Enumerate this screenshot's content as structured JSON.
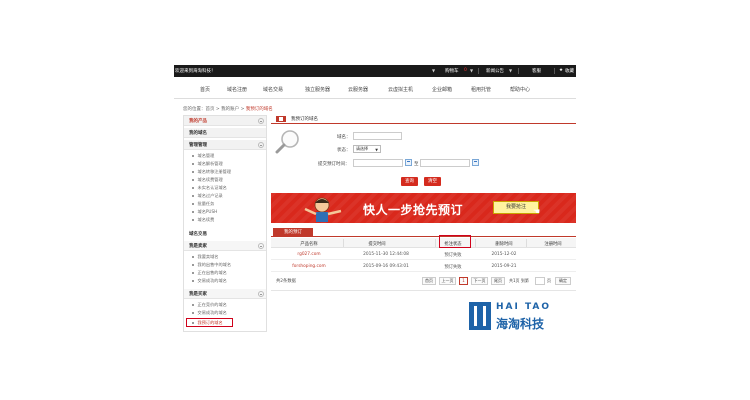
{
  "topbar": {
    "welcome": "欢迎来到海淘科技！",
    "items": [
      "购物车",
      "新闻公告",
      "客服",
      "收藏"
    ],
    "cart_count": "0"
  },
  "nav": [
    "首页",
    "域名注册",
    "域名交易",
    "独立服务器",
    "云服务器",
    "云虚拟主机",
    "企业邮箱",
    "租用托管",
    "帮助中心"
  ],
  "breadcrumb": {
    "prefix": "您的位置：",
    "home": "首页",
    "account": "我的账户",
    "current": "我预订的域名"
  },
  "sidebar": {
    "title": "我的产品",
    "sections": [
      {
        "header": "我的域名",
        "items": []
      },
      {
        "header": "管理管理",
        "items": [
          "域名管理",
          "域名解析管理",
          "域名转移注册管理",
          "域名续费管理",
          "未实名认证域名",
          "域名过户记录",
          "批量任务",
          "域名PUSH",
          "域名续费"
        ]
      },
      {
        "group": "域名交易",
        "items": []
      },
      {
        "group": "我是卖家",
        "items": [
          "我要卖域名",
          "我的出售中的域名",
          "正在出售的域名",
          "交易成功的域名"
        ]
      },
      {
        "group": "我是买家",
        "items": [
          "正在竞价的域名",
          "交易成功的域名",
          "我预订的域名"
        ]
      }
    ]
  },
  "main": {
    "title": "我预订的域名",
    "form": {
      "domain_label": "域名：",
      "status_label": "状态：",
      "status_value": "请选择",
      "date_label": "提交预订时间：",
      "date_sep": "至",
      "search_button": "查询",
      "clear_button": "清空"
    },
    "banner": {
      "headline": "快人一步抢先预订",
      "cta": "我要抢注"
    },
    "tab": "我的预订",
    "table": {
      "columns": [
        "产品名称",
        "提交时间",
        "抢注状态",
        "删除时间",
        "注册时间"
      ],
      "rows": [
        {
          "name": "rg027.com",
          "submit": "2015-11-30 12:44:08",
          "status": "预订失败",
          "delete": "2015-12-02",
          "reg": ""
        },
        {
          "name": "forshoping.com",
          "submit": "2015-09-16 09:43:01",
          "status": "预订失败",
          "delete": "2015-09-21",
          "reg": ""
        }
      ]
    },
    "footer": {
      "total": "共2条数据",
      "pager": [
        "首页",
        "上一页",
        "1",
        "下一页",
        "尾页"
      ],
      "pages_text": "共1页 到第",
      "page_input": "",
      "page_unit": "页",
      "go": "确定"
    }
  },
  "watermark": {
    "en": "HAI TAO",
    "cn": "海淘科技"
  },
  "colors": {
    "accent": "#c0392b",
    "highlight_box": "#d0021b",
    "banner": "#d9281c",
    "topbar": "#1a1a1a",
    "watermark": "#1e63a8"
  }
}
